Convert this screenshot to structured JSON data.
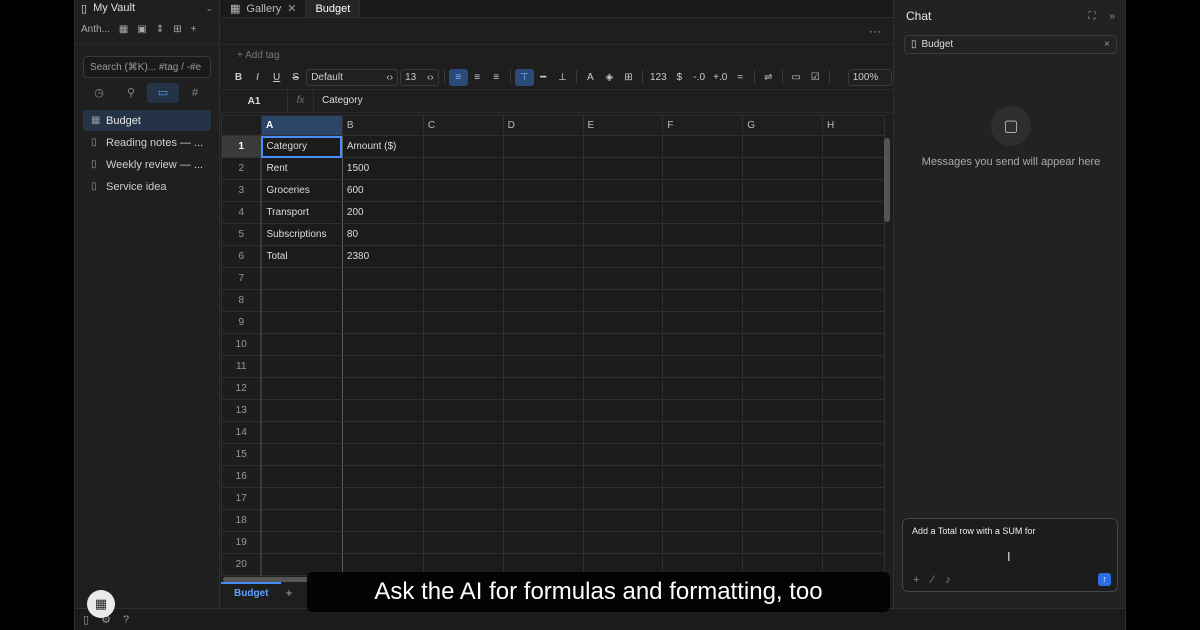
{
  "sidebar": {
    "vault_name": "My Vault",
    "toolbar_label": "Anth...",
    "search_placeholder": "Search (⌘K)... #tag / -#e",
    "files": [
      {
        "label": "Budget",
        "active": true
      },
      {
        "label": "Reading notes — ..."
      },
      {
        "label": "Weekly review — ..."
      },
      {
        "label": "Service idea"
      }
    ]
  },
  "tabs": [
    {
      "label": "Gallery"
    },
    {
      "label": "Budget",
      "active": true
    }
  ],
  "sheet": {
    "add_tag": "+ Add tag",
    "more": "···",
    "font": "Default",
    "font_size": "13",
    "number_format": "123",
    "currency": "$",
    "dec_minus": "-.0",
    "dec_plus": "+.0",
    "approx": "≈",
    "zoom": "100%",
    "cell_ref": "A1",
    "fx": "fx",
    "formula_value": "Category",
    "columns": [
      "A",
      "B",
      "C",
      "D",
      "E",
      "F",
      "G",
      "H"
    ],
    "rows": [
      {
        "n": "1",
        "a": "Category",
        "b": "Amount ($)"
      },
      {
        "n": "2",
        "a": "Rent",
        "b": "1500"
      },
      {
        "n": "3",
        "a": "Groceries",
        "b": "600"
      },
      {
        "n": "4",
        "a": "Transport",
        "b": "200"
      },
      {
        "n": "5",
        "a": "Subscriptions",
        "b": "80"
      },
      {
        "n": "6",
        "a": "Total",
        "b": "2380"
      },
      {
        "n": "7",
        "a": "",
        "b": ""
      },
      {
        "n": "8",
        "a": "",
        "b": ""
      },
      {
        "n": "9",
        "a": "",
        "b": ""
      },
      {
        "n": "10",
        "a": "",
        "b": ""
      },
      {
        "n": "11",
        "a": "",
        "b": ""
      },
      {
        "n": "12",
        "a": "",
        "b": ""
      },
      {
        "n": "13",
        "a": "",
        "b": ""
      },
      {
        "n": "14",
        "a": "",
        "b": ""
      },
      {
        "n": "15",
        "a": "",
        "b": ""
      },
      {
        "n": "16",
        "a": "",
        "b": ""
      },
      {
        "n": "17",
        "a": "",
        "b": ""
      },
      {
        "n": "18",
        "a": "",
        "b": ""
      },
      {
        "n": "19",
        "a": "",
        "b": ""
      },
      {
        "n": "20",
        "a": "",
        "b": ""
      }
    ],
    "sheet_tab": "Budget",
    "add_sheet": "+"
  },
  "chat": {
    "title": "Chat",
    "context_chip": "Budget",
    "empty_message": "Messages you send will appear here",
    "input_text": "Add a Total row with a SUM for",
    "send_icon": "arrow-up-icon"
  },
  "caption": "Ask the AI for formulas and formatting, too",
  "colors": {
    "accent": "#4a8dff",
    "selection_bg": "#253346",
    "send_button": "#2a6ee8"
  }
}
